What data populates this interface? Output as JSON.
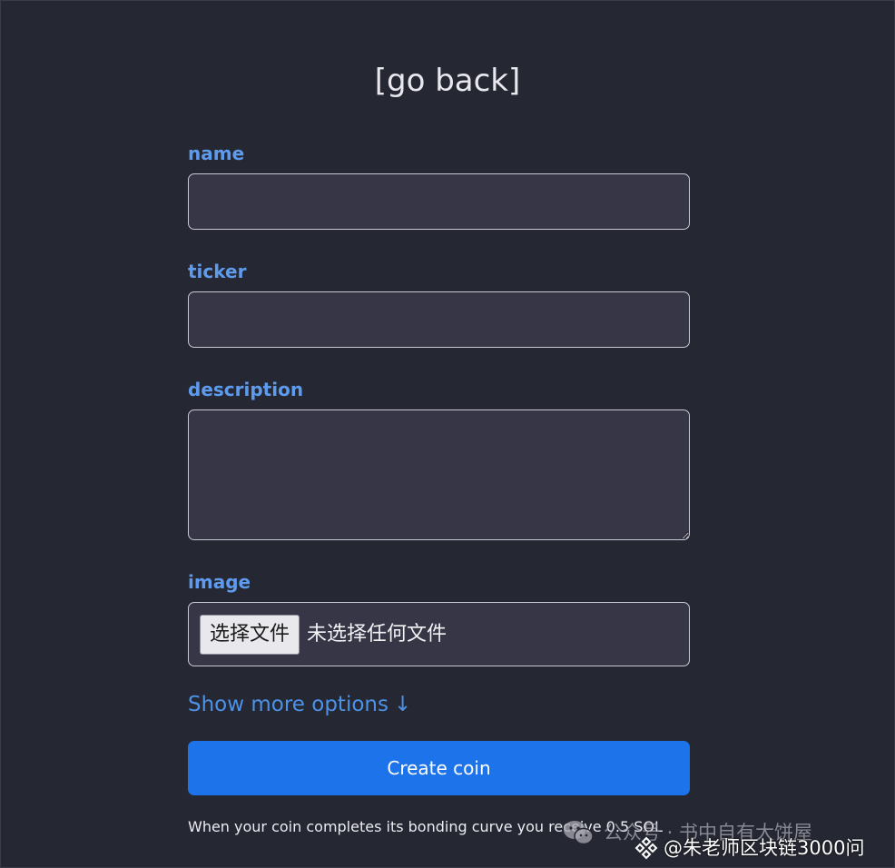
{
  "header": {
    "back_label": "[go back]"
  },
  "form": {
    "name": {
      "label": "name",
      "value": ""
    },
    "ticker": {
      "label": "ticker",
      "value": ""
    },
    "description": {
      "label": "description",
      "value": ""
    },
    "image": {
      "label": "image",
      "button_label": "选择文件",
      "status": "未选择任何文件"
    },
    "more_options_label": "Show more options",
    "more_options_arrow": "↓",
    "submit_label": "Create coin",
    "note": "When your coin completes its bonding curve you receive 0.5 SOL"
  },
  "watermark": {
    "line1": "公众号 · 书中自有大饼屋",
    "line2": "@朱老师区块链3000问",
    "icon_wechat": "wechat-icon",
    "icon_brand": "diamond-logo-icon"
  },
  "colors": {
    "background": "#252732",
    "label": "#5f9bec",
    "link": "#4c92e8",
    "button": "#1c73ea",
    "input_bg": "#363646"
  }
}
